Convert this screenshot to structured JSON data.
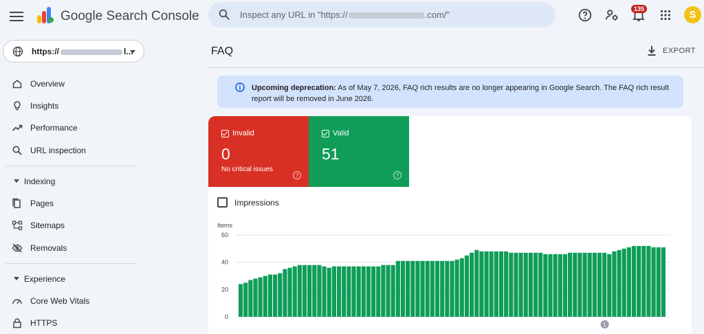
{
  "app": {
    "title": "Google Search Console"
  },
  "search": {
    "placeholder_prefix": "Inspect any URL in \"https://",
    "placeholder_suffix": ".com/\""
  },
  "notifications": {
    "count": "135"
  },
  "account": {
    "initial": "S"
  },
  "property": {
    "label_prefix": "https://",
    "label_suffix": "l..."
  },
  "nav": {
    "items": [
      {
        "label": "Overview",
        "icon": "home-icon"
      },
      {
        "label": "Insights",
        "icon": "lightbulb-icon"
      },
      {
        "label": "Performance",
        "icon": "trending-up-icon"
      },
      {
        "label": "URL inspection",
        "icon": "search-icon"
      }
    ],
    "sections": [
      {
        "label": "Indexing",
        "items": [
          {
            "label": "Pages",
            "icon": "pages-icon"
          },
          {
            "label": "Sitemaps",
            "icon": "sitemap-icon"
          },
          {
            "label": "Removals",
            "icon": "eye-off-icon"
          }
        ]
      },
      {
        "label": "Experience",
        "items": [
          {
            "label": "Core Web Vitals",
            "icon": "speedometer-icon"
          },
          {
            "label": "HTTPS",
            "icon": "lock-icon"
          }
        ]
      }
    ]
  },
  "page": {
    "title": "FAQ",
    "export_label": "EXPORT"
  },
  "banner": {
    "bold": "Upcoming deprecation:",
    "text": " As of May 7, 2026, FAQ rich results are no longer appearing in Google Search. The FAQ rich result report will be removed in June 2026."
  },
  "tiles": {
    "invalid": {
      "label": "Invalid",
      "value": "0",
      "sub": "No critical issues"
    },
    "valid": {
      "label": "Valid",
      "value": "51"
    }
  },
  "impressions": {
    "label": "Impressions"
  },
  "colors": {
    "invalid": "#d93025",
    "valid": "#0f9d58",
    "bar": "#0f9d58"
  },
  "chart_data": {
    "type": "bar",
    "ylabel": "Items",
    "ylim": [
      0,
      60
    ],
    "yticks": [
      0,
      20,
      40,
      60
    ],
    "grid": true,
    "annotation": "1",
    "series": [
      {
        "values": [
          24,
          25,
          27,
          28,
          29,
          30,
          31,
          31,
          32,
          35,
          36,
          37,
          38,
          38,
          38,
          38,
          38,
          37,
          36,
          37,
          37,
          37,
          37,
          37,
          37,
          37,
          37,
          37,
          37,
          38,
          38,
          38,
          41,
          41,
          41,
          41,
          41,
          41,
          41,
          41,
          41,
          41,
          41,
          41,
          42,
          43,
          45,
          47,
          49,
          48,
          48,
          48,
          48,
          48,
          48,
          47,
          47,
          47,
          47,
          47,
          47,
          47,
          46,
          46,
          46,
          46,
          46,
          47,
          47,
          47,
          47,
          47,
          47,
          47,
          47,
          46,
          48,
          49,
          50,
          51,
          52,
          52,
          52,
          52,
          51,
          51,
          51
        ]
      }
    ]
  }
}
